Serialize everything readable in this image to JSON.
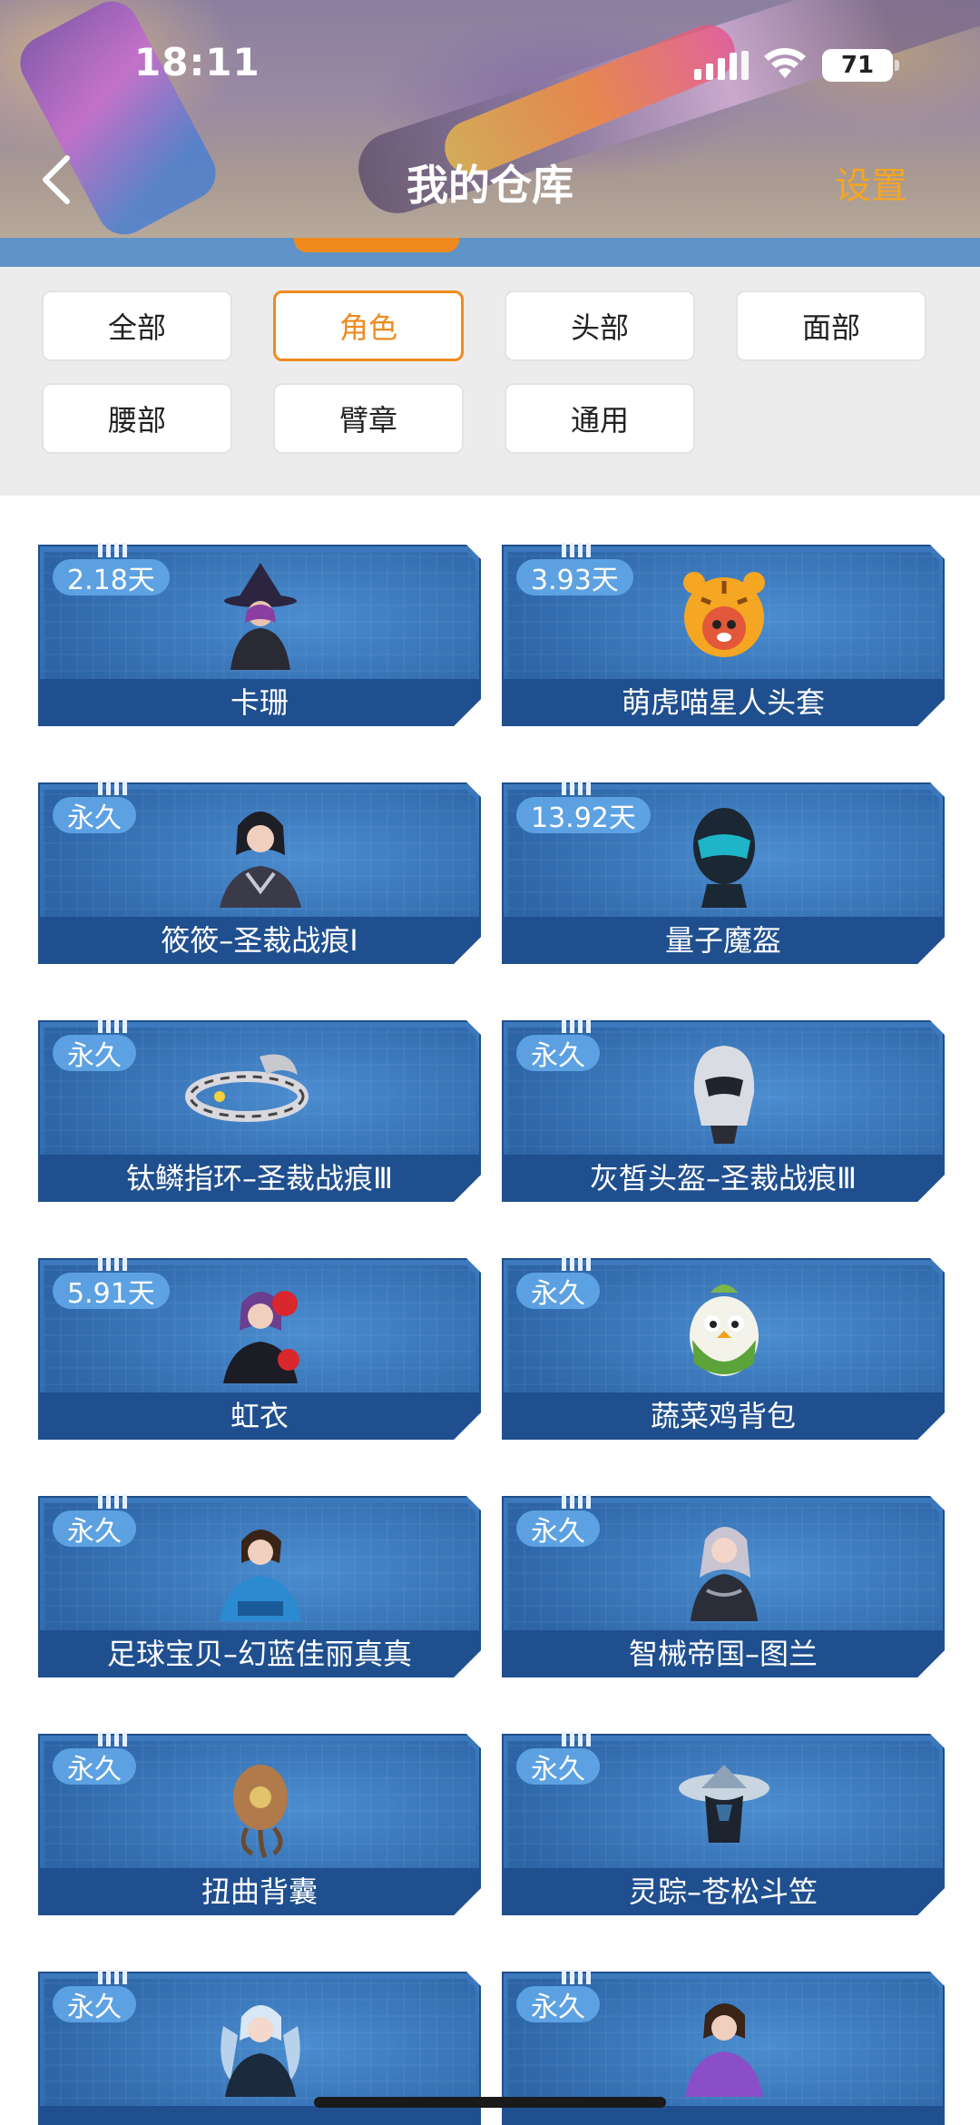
{
  "status_bar": {
    "time": "18:11",
    "battery": "71"
  },
  "header": {
    "title": "我的仓库",
    "settings": "设置"
  },
  "filters": [
    {
      "label": "全部"
    },
    {
      "label": "角色",
      "active": true
    },
    {
      "label": "头部"
    },
    {
      "label": "面部"
    },
    {
      "label": "腰部"
    },
    {
      "label": "臂章"
    },
    {
      "label": "通用"
    }
  ],
  "items": [
    {
      "name": "卡珊",
      "duration": "2.18天",
      "art": "witch-character"
    },
    {
      "name": "萌虎喵星人头套",
      "duration": "3.93天",
      "art": "tiger-mask"
    },
    {
      "name": "筱筱–圣裁战痕Ⅰ",
      "duration": "永久",
      "art": "female-character"
    },
    {
      "name": "量子魔盔",
      "duration": "13.92天",
      "art": "quantum-helmet"
    },
    {
      "name": "钛鳞指环–圣裁战痕Ⅲ",
      "duration": "永久",
      "art": "ring"
    },
    {
      "name": "灰皙头盔–圣裁战痕Ⅲ",
      "duration": "永久",
      "art": "helmet"
    },
    {
      "name": "虹衣",
      "duration": "5.91天",
      "art": "red-flower-character"
    },
    {
      "name": "蔬菜鸡背包",
      "duration": "永久",
      "art": "chicken-backpack"
    },
    {
      "name": "足球宝贝–幻蓝佳丽真真",
      "duration": "永久",
      "art": "football-girl"
    },
    {
      "name": "智械帝国–图兰",
      "duration": "永久",
      "art": "mech-girl"
    },
    {
      "name": "扭曲背囊",
      "duration": "永久",
      "art": "twisted-backpack"
    },
    {
      "name": "灵踪–苍松斗笠",
      "duration": "永久",
      "art": "bamboo-hat"
    },
    {
      "name": "",
      "duration": "永久",
      "art": "twintail-girl"
    },
    {
      "name": "",
      "duration": "永久",
      "art": "purple-girl"
    }
  ],
  "colors": {
    "accent": "#f08a1e",
    "card": "#2f68ac",
    "badge": "#64aaeb"
  }
}
